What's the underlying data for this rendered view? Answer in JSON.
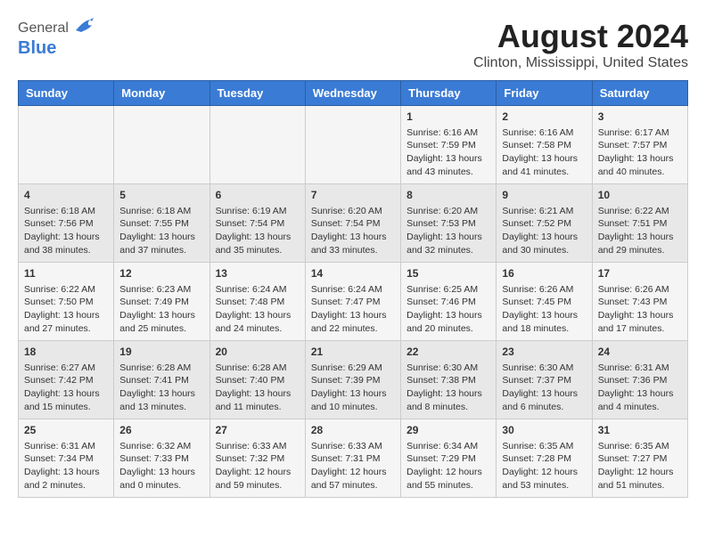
{
  "logo": {
    "general": "General",
    "blue": "Blue"
  },
  "title": "August 2024",
  "subtitle": "Clinton, Mississippi, United States",
  "days_of_week": [
    "Sunday",
    "Monday",
    "Tuesday",
    "Wednesday",
    "Thursday",
    "Friday",
    "Saturday"
  ],
  "weeks": [
    [
      {
        "day": "",
        "content": ""
      },
      {
        "day": "",
        "content": ""
      },
      {
        "day": "",
        "content": ""
      },
      {
        "day": "",
        "content": ""
      },
      {
        "day": "1",
        "content": "Sunrise: 6:16 AM\nSunset: 7:59 PM\nDaylight: 13 hours\nand 43 minutes."
      },
      {
        "day": "2",
        "content": "Sunrise: 6:16 AM\nSunset: 7:58 PM\nDaylight: 13 hours\nand 41 minutes."
      },
      {
        "day": "3",
        "content": "Sunrise: 6:17 AM\nSunset: 7:57 PM\nDaylight: 13 hours\nand 40 minutes."
      }
    ],
    [
      {
        "day": "4",
        "content": "Sunrise: 6:18 AM\nSunset: 7:56 PM\nDaylight: 13 hours\nand 38 minutes."
      },
      {
        "day": "5",
        "content": "Sunrise: 6:18 AM\nSunset: 7:55 PM\nDaylight: 13 hours\nand 37 minutes."
      },
      {
        "day": "6",
        "content": "Sunrise: 6:19 AM\nSunset: 7:54 PM\nDaylight: 13 hours\nand 35 minutes."
      },
      {
        "day": "7",
        "content": "Sunrise: 6:20 AM\nSunset: 7:54 PM\nDaylight: 13 hours\nand 33 minutes."
      },
      {
        "day": "8",
        "content": "Sunrise: 6:20 AM\nSunset: 7:53 PM\nDaylight: 13 hours\nand 32 minutes."
      },
      {
        "day": "9",
        "content": "Sunrise: 6:21 AM\nSunset: 7:52 PM\nDaylight: 13 hours\nand 30 minutes."
      },
      {
        "day": "10",
        "content": "Sunrise: 6:22 AM\nSunset: 7:51 PM\nDaylight: 13 hours\nand 29 minutes."
      }
    ],
    [
      {
        "day": "11",
        "content": "Sunrise: 6:22 AM\nSunset: 7:50 PM\nDaylight: 13 hours\nand 27 minutes."
      },
      {
        "day": "12",
        "content": "Sunrise: 6:23 AM\nSunset: 7:49 PM\nDaylight: 13 hours\nand 25 minutes."
      },
      {
        "day": "13",
        "content": "Sunrise: 6:24 AM\nSunset: 7:48 PM\nDaylight: 13 hours\nand 24 minutes."
      },
      {
        "day": "14",
        "content": "Sunrise: 6:24 AM\nSunset: 7:47 PM\nDaylight: 13 hours\nand 22 minutes."
      },
      {
        "day": "15",
        "content": "Sunrise: 6:25 AM\nSunset: 7:46 PM\nDaylight: 13 hours\nand 20 minutes."
      },
      {
        "day": "16",
        "content": "Sunrise: 6:26 AM\nSunset: 7:45 PM\nDaylight: 13 hours\nand 18 minutes."
      },
      {
        "day": "17",
        "content": "Sunrise: 6:26 AM\nSunset: 7:43 PM\nDaylight: 13 hours\nand 17 minutes."
      }
    ],
    [
      {
        "day": "18",
        "content": "Sunrise: 6:27 AM\nSunset: 7:42 PM\nDaylight: 13 hours\nand 15 minutes."
      },
      {
        "day": "19",
        "content": "Sunrise: 6:28 AM\nSunset: 7:41 PM\nDaylight: 13 hours\nand 13 minutes."
      },
      {
        "day": "20",
        "content": "Sunrise: 6:28 AM\nSunset: 7:40 PM\nDaylight: 13 hours\nand 11 minutes."
      },
      {
        "day": "21",
        "content": "Sunrise: 6:29 AM\nSunset: 7:39 PM\nDaylight: 13 hours\nand 10 minutes."
      },
      {
        "day": "22",
        "content": "Sunrise: 6:30 AM\nSunset: 7:38 PM\nDaylight: 13 hours\nand 8 minutes."
      },
      {
        "day": "23",
        "content": "Sunrise: 6:30 AM\nSunset: 7:37 PM\nDaylight: 13 hours\nand 6 minutes."
      },
      {
        "day": "24",
        "content": "Sunrise: 6:31 AM\nSunset: 7:36 PM\nDaylight: 13 hours\nand 4 minutes."
      }
    ],
    [
      {
        "day": "25",
        "content": "Sunrise: 6:31 AM\nSunset: 7:34 PM\nDaylight: 13 hours\nand 2 minutes."
      },
      {
        "day": "26",
        "content": "Sunrise: 6:32 AM\nSunset: 7:33 PM\nDaylight: 13 hours\nand 0 minutes."
      },
      {
        "day": "27",
        "content": "Sunrise: 6:33 AM\nSunset: 7:32 PM\nDaylight: 12 hours\nand 59 minutes."
      },
      {
        "day": "28",
        "content": "Sunrise: 6:33 AM\nSunset: 7:31 PM\nDaylight: 12 hours\nand 57 minutes."
      },
      {
        "day": "29",
        "content": "Sunrise: 6:34 AM\nSunset: 7:29 PM\nDaylight: 12 hours\nand 55 minutes."
      },
      {
        "day": "30",
        "content": "Sunrise: 6:35 AM\nSunset: 7:28 PM\nDaylight: 12 hours\nand 53 minutes."
      },
      {
        "day": "31",
        "content": "Sunrise: 6:35 AM\nSunset: 7:27 PM\nDaylight: 12 hours\nand 51 minutes."
      }
    ]
  ]
}
